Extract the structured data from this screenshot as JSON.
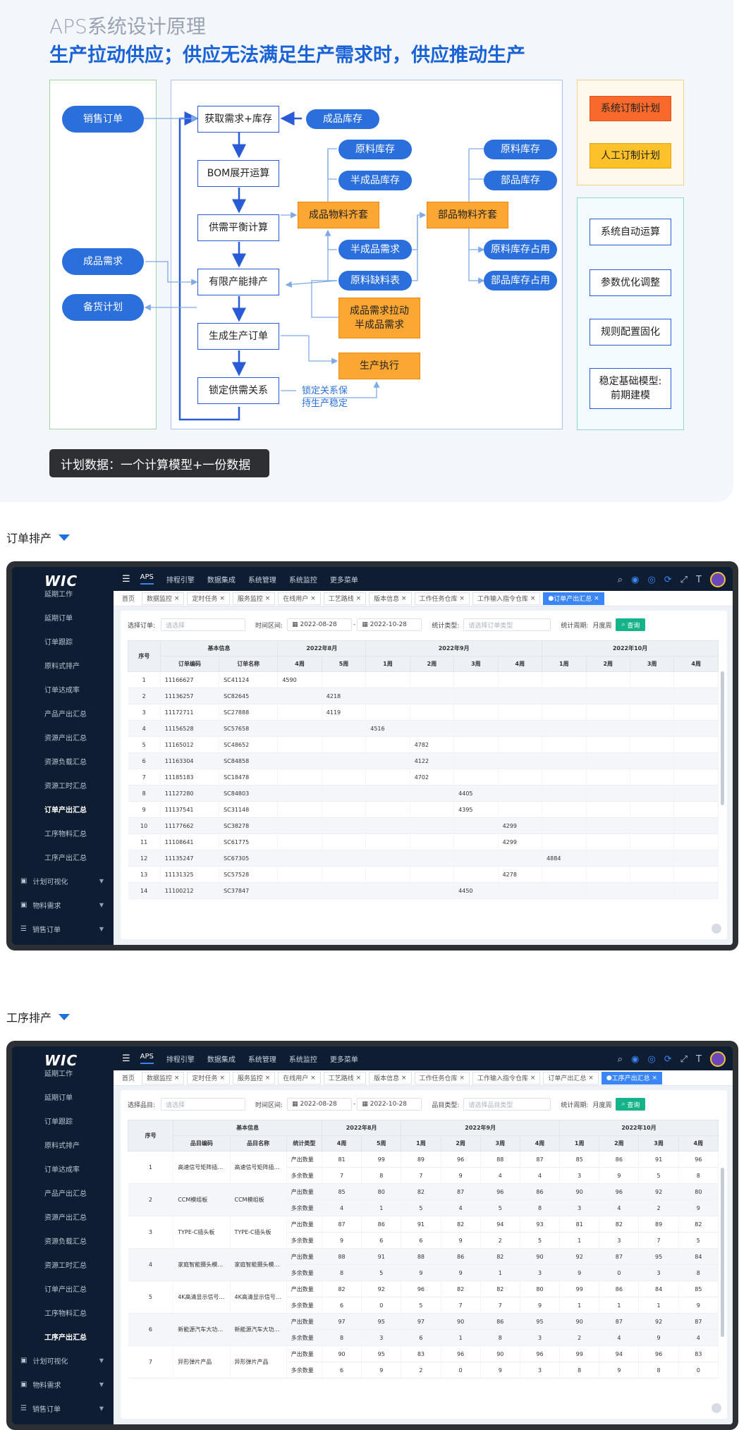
{
  "header": {
    "subtitle_gray": "APS系统设计原理",
    "subtitle_blue": "生产拉动供应；供应无法满足生产需求时，供应推动生产"
  },
  "flow": {
    "left_pills": [
      "销售订单",
      "成品需求",
      "备货计划"
    ],
    "main_boxes": [
      "获取需求+库存",
      "BOM展开运算",
      "供需平衡计算",
      "有限产能排产",
      "生成生产订单",
      "锁定供需关系"
    ],
    "right_pills_a": [
      "成品库存",
      "原料库存",
      "半成品库存",
      "半成品需求",
      "原料缺料表"
    ],
    "right_pills_b": [
      "原料库存",
      "部品库存",
      "原料库存占用",
      "部品库存占用"
    ],
    "orange_boxes": [
      "成品物料齐套",
      "部品物料齐套",
      "成品需求拉动半成品需求",
      "生产执行"
    ],
    "lock_note": [
      "锁定关系保",
      "持生产稳定"
    ],
    "side_orange": [
      "系统订制计划",
      "人工订制计划"
    ],
    "side_cyan": [
      "系统自动运算",
      "参数优化调整",
      "规则配置固化",
      "稳定基础模型:前期建模"
    ],
    "plan_banner": "计划数据：一个计算模型+一份数据"
  },
  "section1": {
    "title": "订单排产"
  },
  "section2": {
    "title": "工序排产"
  },
  "app": {
    "logo": "WIC",
    "sidebar_items": [
      "延期订单",
      "订单跟踪",
      "原料式排产",
      "订单达成率",
      "产品产出汇总",
      "资源产出汇总",
      "资源负载汇总",
      "资源工时汇总",
      "订单产出汇总",
      "工序物料汇总",
      "工序产出汇总"
    ],
    "sidebar_groups": [
      "计划可视化",
      "物料需求",
      "销售订单"
    ],
    "sidebar_top_cut": "延期工作",
    "topnav": [
      "APS",
      "排程引擎",
      "数据集成",
      "系统管理",
      "系统监控",
      "更多菜单"
    ],
    "tabs1": [
      "首页",
      "数据监控",
      "定时任务",
      "服务监控",
      "在线用户",
      "工艺路线",
      "版本信息",
      "工作任务仓库",
      "工作输入指令仓库",
      "订单产出汇总"
    ],
    "tabs2": [
      "首页",
      "数据监控",
      "定时任务",
      "服务监控",
      "在线用户",
      "工艺路线",
      "版本信息",
      "工作任务仓库",
      "工作输入指令仓库",
      "订单产出汇总",
      "工序产出汇总"
    ],
    "filter1": {
      "label_order": "选择订单:",
      "placeholder_order": "请选择",
      "label_range": "时间区间:",
      "date_from": "2022-08-28",
      "date_to": "2022-10-28",
      "label_type": "统计类型:",
      "placeholder_type": "请选择订单类型",
      "label_period": "统计周期:",
      "period_value": "月度周",
      "query": "查询"
    },
    "filter2": {
      "label_item": "选择品目:",
      "placeholder_item": "请选择",
      "label_range": "时间区间:",
      "date_from": "2022-08-28",
      "date_to": "2022-10-28",
      "label_type": "品目类型:",
      "placeholder_type": "请选择品目类型",
      "label_period": "统计周期:",
      "period_value": "月度周",
      "query": "查询"
    }
  },
  "table1": {
    "head_top": [
      "序号",
      "基本信息",
      "2022年8月",
      "2022年9月",
      "2022年10月"
    ],
    "head_sub": [
      "订单编码",
      "订单名称",
      "4周",
      "5周",
      "1周",
      "2周",
      "3周",
      "4周",
      "1周",
      "2周",
      "3周",
      "4周"
    ],
    "rows": [
      [
        "1",
        "11166627",
        "SC41124",
        "4590",
        "",
        "",
        "",
        "",
        "",
        "",
        "",
        "",
        ""
      ],
      [
        "2",
        "11136257",
        "SC82645",
        "",
        "4218",
        "",
        "",
        "",
        "",
        "",
        "",
        "",
        ""
      ],
      [
        "3",
        "11172711",
        "SC27888",
        "",
        "4119",
        "",
        "",
        "",
        "",
        "",
        "",
        "",
        ""
      ],
      [
        "4",
        "11156528",
        "SC57658",
        "",
        "",
        "4516",
        "",
        "",
        "",
        "",
        "",
        "",
        ""
      ],
      [
        "5",
        "11165012",
        "SC48652",
        "",
        "",
        "",
        "4782",
        "",
        "",
        "",
        "",
        "",
        ""
      ],
      [
        "6",
        "11163304",
        "SC84858",
        "",
        "",
        "",
        "4122",
        "",
        "",
        "",
        "",
        "",
        ""
      ],
      [
        "7",
        "11185183",
        "SC18478",
        "",
        "",
        "",
        "4702",
        "",
        "",
        "",
        "",
        "",
        ""
      ],
      [
        "8",
        "11127280",
        "SC84803",
        "",
        "",
        "",
        "",
        "4405",
        "",
        "",
        "",
        "",
        ""
      ],
      [
        "9",
        "11137541",
        "SC31148",
        "",
        "",
        "",
        "",
        "4395",
        "",
        "",
        "",
        "",
        ""
      ],
      [
        "10",
        "11177662",
        "SC38278",
        "",
        "",
        "",
        "",
        "",
        "4299",
        "",
        "",
        "",
        ""
      ],
      [
        "11",
        "11108641",
        "SC61775",
        "",
        "",
        "",
        "",
        "",
        "4299",
        "",
        "",
        "",
        ""
      ],
      [
        "12",
        "11135247",
        "SC67305",
        "",
        "",
        "",
        "",
        "",
        "",
        "4884",
        "",
        "",
        ""
      ],
      [
        "13",
        "11131325",
        "SC57528",
        "",
        "",
        "",
        "",
        "",
        "4278",
        "",
        "",
        "",
        ""
      ],
      [
        "14",
        "11100212",
        "SC37847",
        "",
        "",
        "",
        "",
        "4450",
        "",
        "",
        "",
        "",
        ""
      ]
    ]
  },
  "table2": {
    "head_top": [
      "序号",
      "基本信息",
      "2022年8月",
      "2022年9月",
      "2022年10月"
    ],
    "head_sub": [
      "品目编码",
      "品目名称",
      "统计类型",
      "4周",
      "5周",
      "1周",
      "2周",
      "3周",
      "4周",
      "1周",
      "2周",
      "3周",
      "4周"
    ],
    "stat_types": [
      "产出数量",
      "多余数量"
    ],
    "rows": [
      {
        "no": "1",
        "code": "高速信号矩阵插…",
        "name": "高速信号矩阵插…",
        "out": [
          "81",
          "99",
          "89",
          "96",
          "88",
          "87",
          "85",
          "86",
          "91",
          "96"
        ],
        "extra": [
          "7",
          "8",
          "7",
          "9",
          "4",
          "4",
          "3",
          "9",
          "5",
          "8"
        ]
      },
      {
        "no": "2",
        "code": "CCM模组板",
        "name": "CCM模组板",
        "out": [
          "85",
          "80",
          "82",
          "87",
          "96",
          "86",
          "90",
          "96",
          "92",
          "80"
        ],
        "extra": [
          "4",
          "1",
          "5",
          "4",
          "5",
          "8",
          "3",
          "4",
          "2",
          "9"
        ]
      },
      {
        "no": "3",
        "code": "TYPE-C插头板",
        "name": "TYPE-C插头板",
        "out": [
          "87",
          "86",
          "91",
          "82",
          "94",
          "93",
          "81",
          "82",
          "89",
          "82"
        ],
        "extra": [
          "9",
          "6",
          "6",
          "9",
          "2",
          "5",
          "1",
          "3",
          "7",
          "5"
        ]
      },
      {
        "no": "4",
        "code": "家庭智能摄头模…",
        "name": "家庭智能摄头模…",
        "out": [
          "88",
          "91",
          "88",
          "86",
          "82",
          "90",
          "92",
          "87",
          "95",
          "84"
        ],
        "extra": [
          "8",
          "5",
          "9",
          "9",
          "1",
          "3",
          "9",
          "0",
          "3",
          "8"
        ]
      },
      {
        "no": "5",
        "code": "4K高清显示信号…",
        "name": "4K高清显示信号…",
        "out": [
          "82",
          "92",
          "96",
          "82",
          "82",
          "80",
          "99",
          "86",
          "84",
          "85"
        ],
        "extra": [
          "6",
          "0",
          "5",
          "7",
          "7",
          "9",
          "1",
          "1",
          "1",
          "9"
        ]
      },
      {
        "no": "6",
        "code": "新能源汽车大功…",
        "name": "新能源汽车大功…",
        "out": [
          "97",
          "95",
          "97",
          "90",
          "86",
          "95",
          "90",
          "87",
          "92",
          "87"
        ],
        "extra": [
          "8",
          "3",
          "6",
          "1",
          "8",
          "3",
          "2",
          "4",
          "9",
          "4"
        ]
      },
      {
        "no": "7",
        "code": "异形弹片产品",
        "name": "异形弹片产品",
        "out": [
          "90",
          "95",
          "83",
          "96",
          "90",
          "96",
          "99",
          "94",
          "96",
          "83"
        ],
        "extra": [
          "6",
          "9",
          "2",
          "0",
          "9",
          "3",
          "8",
          "9",
          "8",
          "0"
        ]
      }
    ]
  }
}
